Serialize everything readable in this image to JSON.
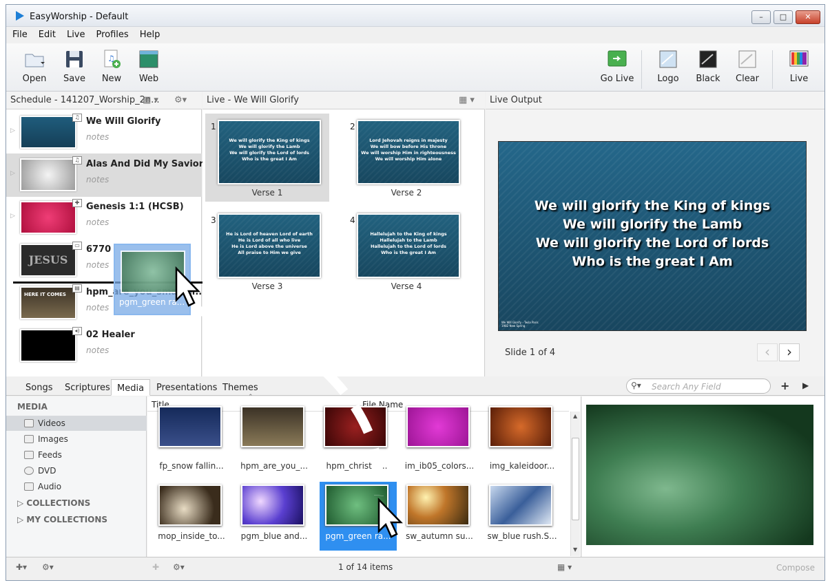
{
  "window": {
    "title": "EasyWorship - Default",
    "min": "–",
    "max": "□",
    "close": "✕"
  },
  "menu": [
    "File",
    "Edit",
    "Live",
    "Profiles",
    "Help"
  ],
  "toolbar": {
    "open": "Open",
    "save": "Save",
    "new": "New",
    "web": "Web",
    "golive": "Go Live",
    "logo": "Logo",
    "black": "Black",
    "clear": "Clear",
    "live": "Live"
  },
  "schedule": {
    "header": "Schedule - 141207_Worship_2n...",
    "items": [
      {
        "name": "We Will Glorify",
        "notes": "notes"
      },
      {
        "name": "Alas And Did My Savior Bl...",
        "notes": "notes"
      },
      {
        "name": "Genesis 1:1 (HCSB)",
        "notes": "notes"
      },
      {
        "name": "6770",
        "notes": "notes"
      },
      {
        "name": "hpm_are_you_smarter...",
        "notes": "notes"
      },
      {
        "name": "02 Healer",
        "notes": "notes"
      }
    ],
    "thumb_text": {
      "jesus": "JESUS",
      "here": "HERE IT COMES"
    },
    "drag_label": "pgm_green ra..."
  },
  "live_panel": {
    "header": "Live - We Will Glorify",
    "slides": [
      {
        "num": "1",
        "caption": "Verse 1",
        "lines": [
          "We will glorify the King of kings",
          "We will glorify the Lamb",
          "We will glorify the Lord of lords",
          "Who is the great I Am"
        ]
      },
      {
        "num": "2",
        "caption": "Verse 2",
        "lines": [
          "Lord Jehovah reigns in majesty",
          "We will bow before His throne",
          "We will worship Him in righteousness",
          "We will worship Him alone"
        ]
      },
      {
        "num": "3",
        "caption": "Verse 3",
        "lines": [
          "He is Lord of heaven Lord of earth",
          "He is Lord of all who live",
          "He is Lord above the universe",
          "All praise to Him we give"
        ]
      },
      {
        "num": "4",
        "caption": "Verse 4",
        "lines": [
          "Hallelujah to the King of kings",
          "Hallelujah to the Lamb",
          "Hallelujah to the Lord of lords",
          "Who is the great I Am"
        ]
      }
    ]
  },
  "live_output": {
    "header": "Live Output",
    "lines": [
      "We will glorify the King of kings",
      "We will glorify the Lamb",
      "We will glorify the Lord of lords",
      "Who is the great I Am"
    ],
    "credit1": "We Will Glorify - Twila Paris",
    "credit2": "1982 New Spring",
    "slide_status": "Slide 1 of 4",
    "prev": "‹",
    "next": "›"
  },
  "tabs": [
    "Songs",
    "Scriptures",
    "Media",
    "Presentations",
    "Themes"
  ],
  "search": {
    "placeholder": "Search Any Field"
  },
  "library": {
    "heading": "MEDIA",
    "items": [
      "Videos",
      "Images",
      "Feeds",
      "DVD",
      "Audio"
    ],
    "collections": "COLLECTIONS",
    "my_collections": "MY COLLECTIONS"
  },
  "columns": {
    "title": "Title",
    "filename": "File Name"
  },
  "media_row1": [
    "fp_snow fallin...",
    "hpm_are_you_...",
    "hpm_christ a...",
    "im_ib05_colors...",
    "img_kaleidoor..."
  ],
  "media_row2": [
    "mop_inside_to...",
    "pgm_blue and...",
    "pgm_green ra...",
    "sw_autumn su...",
    "sw_blue rush.S..."
  ],
  "status": {
    "items": "1 of 14 items",
    "compose": "Compose"
  }
}
